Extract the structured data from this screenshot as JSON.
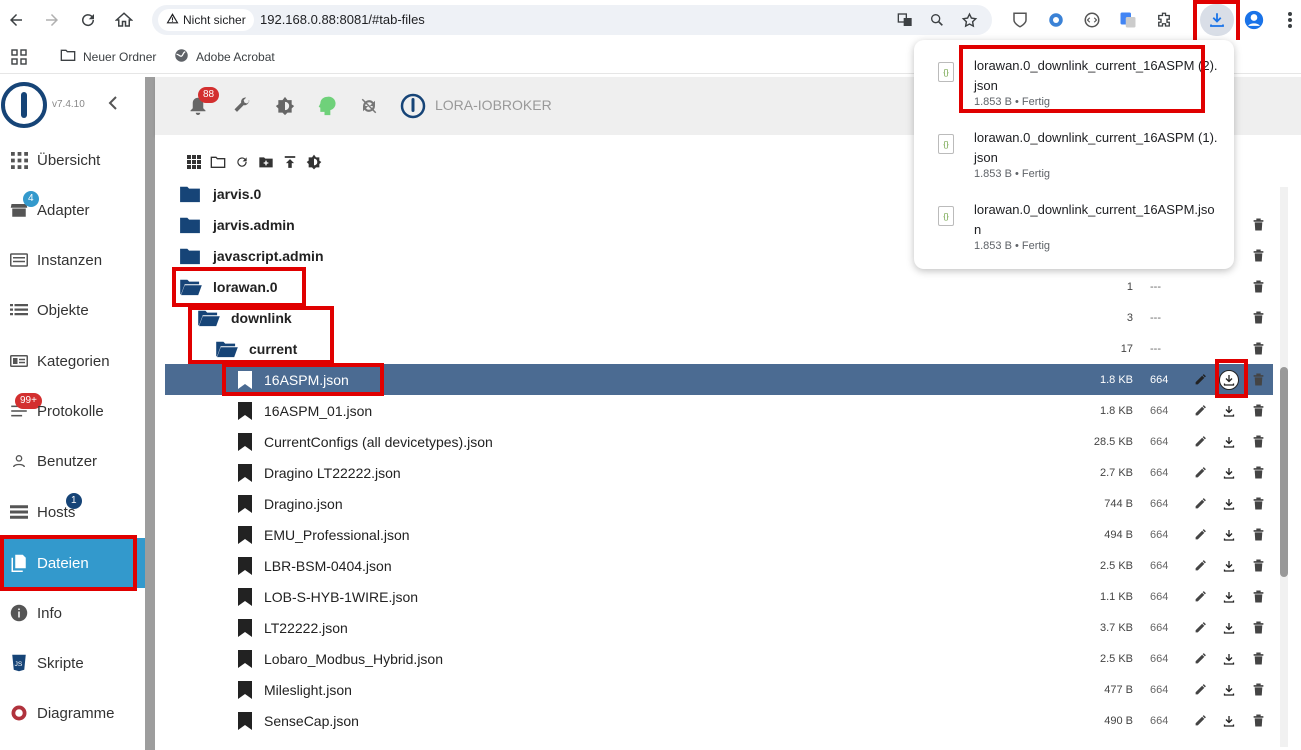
{
  "browser": {
    "secure_label": "Nicht sicher",
    "url": "192.168.0.88:8081/#tab-files",
    "bookmarks": [
      {
        "label": "Neuer Ordner"
      },
      {
        "label": "Adobe Acrobat"
      }
    ]
  },
  "downloads": [
    {
      "name": "lorawan.0_downlink_current_16ASPM (2).json",
      "meta": "1.853 B • Fertig"
    },
    {
      "name": "lorawan.0_downlink_current_16ASPM (1).json",
      "meta": "1.853 B • Fertig"
    },
    {
      "name": "lorawan.0_downlink_current_16ASPM.json",
      "meta": "1.853 B • Fertig"
    }
  ],
  "sidebar": {
    "version": "v7.4.10",
    "items": [
      {
        "label": "Übersicht",
        "icon": "grid-icon"
      },
      {
        "label": "Adapter",
        "icon": "store-icon",
        "badge": "4"
      },
      {
        "label": "Instanzen",
        "icon": "instances-icon"
      },
      {
        "label": "Objekte",
        "icon": "list-icon"
      },
      {
        "label": "Kategorien",
        "icon": "categories-icon"
      },
      {
        "label": "Protokolle",
        "icon": "log-icon",
        "badge": "99+"
      },
      {
        "label": "Benutzer",
        "icon": "user-icon"
      },
      {
        "label": "Hosts",
        "icon": "hosts-icon",
        "badge": "1"
      },
      {
        "label": "Dateien",
        "icon": "files-icon",
        "active": true
      },
      {
        "label": "Info",
        "icon": "info-icon"
      },
      {
        "label": "Skripte",
        "icon": "js-icon"
      },
      {
        "label": "Diagramme",
        "icon": "chart-icon"
      }
    ]
  },
  "topbar": {
    "notification_count": "88",
    "host_name": "LORA-IOBROKER"
  },
  "files": {
    "rows": [
      {
        "name": "jarvis.0",
        "type": "folder",
        "size": "",
        "count": "",
        "perm": ""
      },
      {
        "name": "jarvis.admin",
        "type": "folder",
        "size": "",
        "count": "",
        "perm": ""
      },
      {
        "name": "javascript.admin",
        "type": "folder",
        "size": "",
        "count": "",
        "perm": ""
      },
      {
        "name": "lorawan.0",
        "type": "folder-open",
        "size": "1",
        "perm": "---"
      },
      {
        "name": "downlink",
        "type": "folder-open",
        "size": "3",
        "perm": "---"
      },
      {
        "name": "current",
        "type": "folder-open",
        "size": "17",
        "perm": "---"
      },
      {
        "name": "16ASPM.json",
        "type": "file",
        "size": "1.8 KB",
        "perm": "664",
        "selected": true
      },
      {
        "name": "16ASPM_01.json",
        "type": "file",
        "size": "1.8 KB",
        "perm": "664"
      },
      {
        "name": "CurrentConfigs (all devicetypes).json",
        "type": "file",
        "size": "28.5 KB",
        "perm": "664"
      },
      {
        "name": "Dragino LT22222.json",
        "type": "file",
        "size": "2.7 KB",
        "perm": "664"
      },
      {
        "name": "Dragino.json",
        "type": "file",
        "size": "744 B",
        "perm": "664"
      },
      {
        "name": "EMU_Professional.json",
        "type": "file",
        "size": "494 B",
        "perm": "664"
      },
      {
        "name": "LBR-BSM-0404.json",
        "type": "file",
        "size": "2.5 KB",
        "perm": "664"
      },
      {
        "name": "LOB-S-HYB-1WIRE.json",
        "type": "file",
        "size": "1.1 KB",
        "perm": "664"
      },
      {
        "name": "LT22222.json",
        "type": "file",
        "size": "3.7 KB",
        "perm": "664"
      },
      {
        "name": "Lobaro_Modbus_Hybrid.json",
        "type": "file",
        "size": "2.5 KB",
        "perm": "664"
      },
      {
        "name": "Mileslight.json",
        "type": "file",
        "size": "477 B",
        "perm": "664"
      },
      {
        "name": "SenseCap.json",
        "type": "file",
        "size": "490 B",
        "perm": "664"
      }
    ]
  },
  "colors": {
    "accent": "#3399cc",
    "selected_row": "#4b6b92",
    "highlight": "#e00000",
    "brand": "#164477"
  }
}
